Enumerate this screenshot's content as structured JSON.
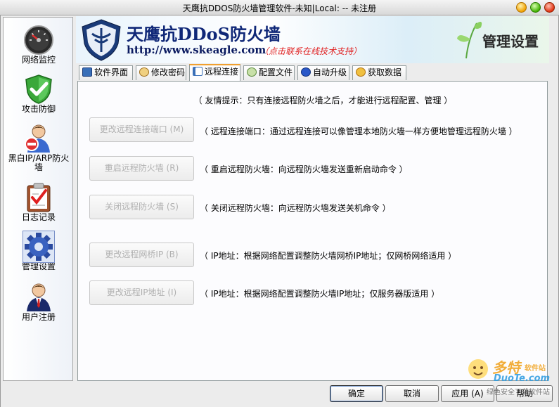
{
  "window": {
    "title": "天鹰抗DDOS防火墙管理软件-未知|Local: -- 未注册"
  },
  "sidebar": {
    "items": [
      {
        "label": "网络监控",
        "icon": "gauge-icon"
      },
      {
        "label": "攻击防御",
        "icon": "shield-check-icon"
      },
      {
        "label": "黑白IP/ARP防火墙",
        "icon": "user-block-icon"
      },
      {
        "label": "日志记录",
        "icon": "clipboard-check-icon"
      },
      {
        "label": "管理设置",
        "icon": "gear-icon"
      },
      {
        "label": "用户注册",
        "icon": "user-tie-icon"
      }
    ],
    "active": "管理设置"
  },
  "banner": {
    "brand": "天鹰抗DDoS防火墙",
    "url": "http://www.skeagle.com",
    "hint": "（点击联系在线技术支持）",
    "page_title": "管理设置"
  },
  "tabs": [
    {
      "label": "软件界面",
      "icon": "window-icon",
      "color": "#3a6fb8"
    },
    {
      "label": "修改密码",
      "icon": "key-icon",
      "color": "#c89030"
    },
    {
      "label": "远程连接",
      "icon": "remote-icon",
      "color": "#3a6fb8"
    },
    {
      "label": "配置文件",
      "icon": "config-icon",
      "color": "#5a8a3a"
    },
    {
      "label": "自动升级",
      "icon": "update-icon",
      "color": "#2a58c8"
    },
    {
      "label": "获取数据",
      "icon": "data-icon",
      "color": "#e0a020"
    }
  ],
  "active_tab": "远程连接",
  "content": {
    "tip": "（ 友情提示：只有连接远程防火墙之后，才能进行远程配置、管理 ）",
    "actions": [
      {
        "button": "更改远程连接端口 (M)",
        "desc": "（ 远程连接端口：通过远程连接可以像管理本地防火墙一样方便地管理远程防火墙 ）"
      },
      {
        "button": "重启远程防火墙 (R)",
        "desc": "（ 重启远程防火墙：向远程防火墙发送重新启动命令 ）"
      },
      {
        "button": "关闭远程防火墙 (S)",
        "desc": "（ 关闭远程防火墙：向远程防火墙发送关机命令 ）"
      },
      {
        "button": "更改远程网桥IP (B)",
        "desc": "（ IP地址：根据网络配置调整防火墙网桥IP地址；仅网桥网络适用 ）"
      },
      {
        "button": "更改远程IP地址 (I)",
        "desc": "（ IP地址：根据网络配置调整防火墙IP地址；仅服务器版适用 ）"
      }
    ]
  },
  "footer": {
    "ok": "确定",
    "cancel": "取消",
    "apply": "应用 (A)",
    "help": "帮助"
  },
  "watermark": {
    "brand": "多特",
    "sub": "软件站",
    "domain": "DuoTe.com",
    "line": "绿色安全下载软件站"
  },
  "colors": {
    "brand_blue": "#102878",
    "hint_red": "#e02020",
    "tab_accent": "#f0a030"
  }
}
